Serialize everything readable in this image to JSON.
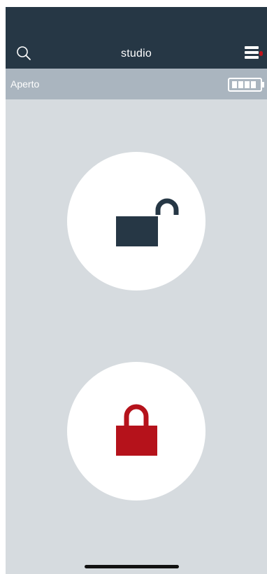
{
  "header": {
    "title": "studio",
    "search_icon": "search-icon",
    "menu_icon": "hamburger-menu-icon"
  },
  "status": {
    "text": "Aperto",
    "battery_icon": "battery-full-icon",
    "battery_level": 1.0
  },
  "actions": {
    "unlock_icon": "unlock-icon",
    "lock_icon": "lock-icon"
  },
  "colors": {
    "header_bg": "#263745",
    "status_bg": "#aab5bf",
    "background": "#d6dbdf",
    "unlock_icon": "#263745",
    "lock_icon": "#b5121b",
    "notification": "#c0141c"
  }
}
